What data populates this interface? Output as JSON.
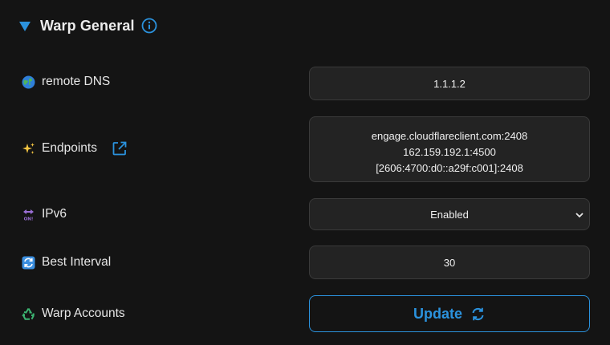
{
  "section": {
    "title": "Warp General",
    "accent_color": "#2b92dd"
  },
  "rows": {
    "remote_dns": {
      "label": "remote DNS",
      "icon": "globe-icon",
      "value": "1.1.1.2"
    },
    "endpoints": {
      "label": "Endpoints",
      "icon": "sparkles-icon",
      "link_icon": "external-link-icon",
      "value": "engage.cloudflareclient.com:2408\n162.159.192.1:4500\n[2606:4700:d0::a29f:c001]:2408"
    },
    "ipv6": {
      "label": "IPv6",
      "icon": "on-arrow-icon",
      "value": "Enabled"
    },
    "best_interval": {
      "label": "Best Interval",
      "icon": "repeat-icon",
      "value": "30"
    },
    "warp_accounts": {
      "label": "Warp Accounts",
      "icon": "recycle-icon",
      "button_label": "Update",
      "button_icon": "refresh-icon"
    }
  }
}
